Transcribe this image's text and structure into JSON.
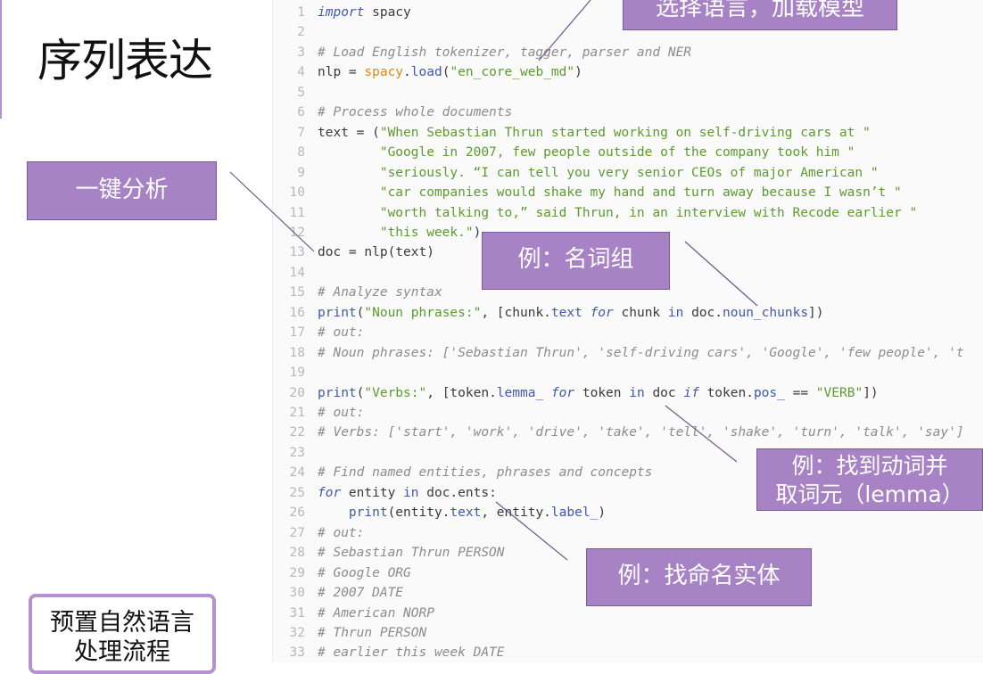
{
  "slide": {
    "title": "序列表达"
  },
  "code": {
    "lines": [
      {
        "n": "1",
        "tokens": [
          [
            "kw",
            "import"
          ],
          [
            "pl",
            " spacy"
          ]
        ]
      },
      {
        "n": "2",
        "tokens": []
      },
      {
        "n": "3",
        "tokens": [
          [
            "cm",
            "# Load English tokenizer, tagger, parser and NER"
          ]
        ]
      },
      {
        "n": "4",
        "tokens": [
          [
            "pl",
            "nlp = "
          ],
          [
            "bi",
            "spacy"
          ],
          [
            "pl",
            "."
          ],
          [
            "fn",
            "load"
          ],
          [
            "pl",
            "("
          ],
          [
            "str",
            "\"en_core_web_md\""
          ],
          [
            "pl",
            ")"
          ]
        ]
      },
      {
        "n": "5",
        "tokens": []
      },
      {
        "n": "6",
        "tokens": [
          [
            "cm",
            "# Process whole documents"
          ]
        ]
      },
      {
        "n": "7",
        "tokens": [
          [
            "pl",
            "text = ("
          ],
          [
            "str",
            "\"When Sebastian Thrun started working on self-driving cars at \""
          ]
        ]
      },
      {
        "n": "8",
        "tokens": [
          [
            "pl",
            "        "
          ],
          [
            "str",
            "\"Google in 2007, few people outside of the company took him \""
          ]
        ]
      },
      {
        "n": "9",
        "tokens": [
          [
            "pl",
            "        "
          ],
          [
            "str",
            "\"seriously. “I can tell you very senior CEOs of major American \""
          ]
        ]
      },
      {
        "n": "10",
        "tokens": [
          [
            "pl",
            "        "
          ],
          [
            "str",
            "\"car companies would shake my hand and turn away because I wasn’t \""
          ]
        ]
      },
      {
        "n": "11",
        "tokens": [
          [
            "pl",
            "        "
          ],
          [
            "str",
            "\"worth talking to,” said Thrun, in an interview with Recode earlier \""
          ]
        ]
      },
      {
        "n": "12",
        "tokens": [
          [
            "pl",
            "        "
          ],
          [
            "str",
            "\"this week.\""
          ],
          [
            "pl",
            ")"
          ]
        ]
      },
      {
        "n": "13",
        "tokens": [
          [
            "pl",
            "doc = nlp(text)"
          ]
        ]
      },
      {
        "n": "14",
        "tokens": []
      },
      {
        "n": "15",
        "tokens": [
          [
            "cm",
            "# Analyze syntax"
          ]
        ]
      },
      {
        "n": "16",
        "tokens": [
          [
            "fn",
            "print"
          ],
          [
            "pl",
            "("
          ],
          [
            "str",
            "\"Noun phrases:\""
          ],
          [
            "pl",
            ", [chunk."
          ],
          [
            "pr",
            "text"
          ],
          [
            "pl",
            " "
          ],
          [
            "kw",
            "for"
          ],
          [
            "pl",
            " chunk "
          ],
          [
            "fn",
            "in"
          ],
          [
            "pl",
            " doc."
          ],
          [
            "pr",
            "noun_chunks"
          ],
          [
            "pl",
            "])"
          ]
        ]
      },
      {
        "n": "17",
        "tokens": [
          [
            "cm",
            "# out:"
          ]
        ]
      },
      {
        "n": "18",
        "tokens": [
          [
            "cm",
            "# Noun phrases: ['Sebastian Thrun', 'self-driving cars', 'Google', 'few people', 't"
          ]
        ]
      },
      {
        "n": "19",
        "tokens": []
      },
      {
        "n": "20",
        "tokens": [
          [
            "fn",
            "print"
          ],
          [
            "pl",
            "("
          ],
          [
            "str",
            "\"Verbs:\""
          ],
          [
            "pl",
            ", [token."
          ],
          [
            "pr",
            "lemma_"
          ],
          [
            "pl",
            " "
          ],
          [
            "kw",
            "for"
          ],
          [
            "pl",
            " token "
          ],
          [
            "fn",
            "in"
          ],
          [
            "pl",
            " doc "
          ],
          [
            "kw",
            "if"
          ],
          [
            "pl",
            " token."
          ],
          [
            "pr",
            "pos_"
          ],
          [
            "pl",
            " == "
          ],
          [
            "str",
            "\"VERB\""
          ],
          [
            "pl",
            "])"
          ]
        ]
      },
      {
        "n": "21",
        "tokens": [
          [
            "cm",
            "# out:"
          ]
        ]
      },
      {
        "n": "22",
        "tokens": [
          [
            "cm",
            "# Verbs: ['start', 'work', 'drive', 'take', 'tell', 'shake', 'turn', 'talk', 'say']"
          ]
        ]
      },
      {
        "n": "23",
        "tokens": []
      },
      {
        "n": "24",
        "tokens": [
          [
            "cm",
            "# Find named entities, phrases and concepts"
          ]
        ]
      },
      {
        "n": "25",
        "tokens": [
          [
            "kw",
            "for"
          ],
          [
            "pl",
            " entity "
          ],
          [
            "fn",
            "in"
          ],
          [
            "pl",
            " doc.ents:"
          ]
        ]
      },
      {
        "n": "26",
        "tokens": [
          [
            "pl",
            "    "
          ],
          [
            "fn",
            "print"
          ],
          [
            "pl",
            "(entity."
          ],
          [
            "pr",
            "text"
          ],
          [
            "pl",
            ", entity."
          ],
          [
            "pr",
            "label_"
          ],
          [
            "pl",
            ")"
          ]
        ]
      },
      {
        "n": "27",
        "tokens": [
          [
            "cm",
            "# out:"
          ]
        ]
      },
      {
        "n": "28",
        "tokens": [
          [
            "cm",
            "# Sebastian Thrun PERSON"
          ]
        ]
      },
      {
        "n": "29",
        "tokens": [
          [
            "cm",
            "# Google ORG"
          ]
        ]
      },
      {
        "n": "30",
        "tokens": [
          [
            "cm",
            "# 2007 DATE"
          ]
        ]
      },
      {
        "n": "31",
        "tokens": [
          [
            "cm",
            "# American NORP"
          ]
        ]
      },
      {
        "n": "32",
        "tokens": [
          [
            "cm",
            "# Thrun PERSON"
          ]
        ]
      },
      {
        "n": "33",
        "tokens": [
          [
            "cm",
            "# earlier this week DATE"
          ]
        ]
      }
    ]
  },
  "callouts": {
    "select_language": "选择语言，加载模型",
    "one_click": "一键分析",
    "noun_chunks": "例：名词组",
    "verbs_line1": "例：找到动词并",
    "verbs_line2": "取词元（lemma）",
    "entities": "例：找命名实体",
    "pipeline_line1": "预置自然语言",
    "pipeline_line2": "处理流程"
  },
  "colors": {
    "callout_fill": "#a783c6",
    "accent": "#b592c9"
  }
}
